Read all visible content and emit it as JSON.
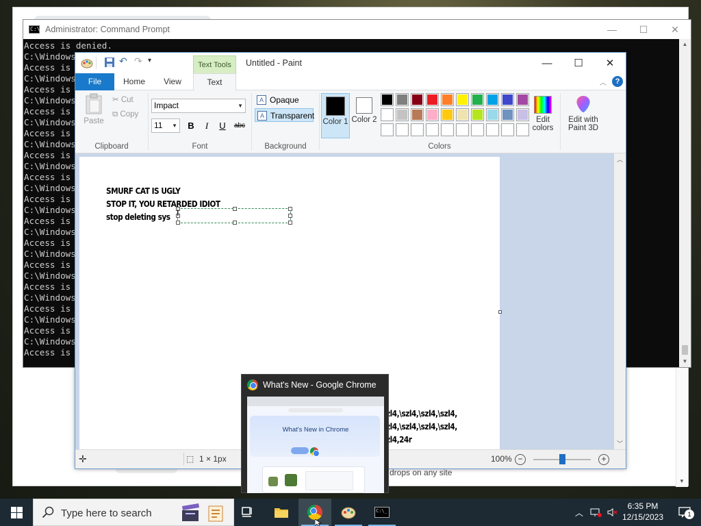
{
  "background_window": {
    "snippet_text": "drops on any site"
  },
  "cmd": {
    "title": "Administrator: Command Prompt",
    "controls": [
      "—",
      "☐",
      "✕"
    ],
    "lines": [
      "Access is denied.",
      "C:\\Windows",
      "Access is",
      "C:\\Windows",
      "Access is",
      "C:\\Windows",
      "Access is",
      "C:\\Windows",
      "Access is",
      "C:\\Windows",
      "Access is",
      "C:\\Windows",
      "Access is",
      "C:\\Windows",
      "Access is",
      "C:\\Windows",
      "Access is",
      "C:\\Windows",
      "Access is",
      "C:\\Windows",
      "Access is",
      "C:\\Windows",
      "Access is",
      "C:\\Windows",
      "Access is",
      "C:\\Windows",
      "Access is",
      "C:\\Windows",
      "Access is",
      "",
      "C:\\Windows"
    ]
  },
  "paint": {
    "title": "Untitled - Paint",
    "text_tools_label": "Text Tools",
    "tabs": {
      "file": "File",
      "home": "Home",
      "view": "View",
      "text": "Text"
    },
    "clipboard": {
      "paste": "Paste",
      "cut": "Cut",
      "copy": "Copy",
      "label": "Clipboard"
    },
    "font": {
      "family": "Impact",
      "size": "11",
      "bold": "B",
      "italic": "I",
      "underline": "U",
      "strike": "abc",
      "label": "Font"
    },
    "background": {
      "opaque": "Opaque",
      "transparent": "Transparent",
      "label": "Background"
    },
    "colors": {
      "color1_label": "Color 1",
      "color2_label": "Color 2",
      "color1": "#000000",
      "color2": "#ffffff",
      "label": "Colors",
      "palette_row1": [
        "#000000",
        "#7f7f7f",
        "#880015",
        "#ed1c24",
        "#ff7f27",
        "#fff200",
        "#22b14c",
        "#00a2e8",
        "#3f48cc",
        "#a349a4"
      ],
      "palette_row2": [
        "#ffffff",
        "#c3c3c3",
        "#b97a57",
        "#ffaec9",
        "#ffc90e",
        "#efe4b0",
        "#b5e61d",
        "#99d9ea",
        "#7092be",
        "#c8bfe7"
      ],
      "palette_row3": [
        "#ffffff",
        "#ffffff",
        "#ffffff",
        "#ffffff",
        "#ffffff",
        "#ffffff",
        "#ffffff",
        "#ffffff",
        "#ffffff",
        "#ffffff"
      ],
      "edit_colors": "Edit colors",
      "edit_paint3d": "Edit with Paint 3D"
    },
    "canvas_lines": [
      "SMURF CAT IS UGLY",
      "STOP IT, YOU RETARDED IDIOT",
      "stop deleting sys"
    ],
    "bottom_text_lines": [
      "zl4,\\szl4,\\szl4,\\szl4,",
      "zl4,\\szl4,\\szl4,\\szl4,",
      "zl4,24r"
    ],
    "status": {
      "selection_size": "1 × 1px",
      "zoom": "100%",
      "zoom_level_fraction": 0.5
    }
  },
  "chrome_preview": {
    "title": "What's New - Google Chrome",
    "heading": "What's New in Chrome"
  },
  "taskbar": {
    "search_placeholder": "Type here to search",
    "time": "6:35 PM",
    "date": "12/15/2023",
    "notification_count": "1"
  }
}
